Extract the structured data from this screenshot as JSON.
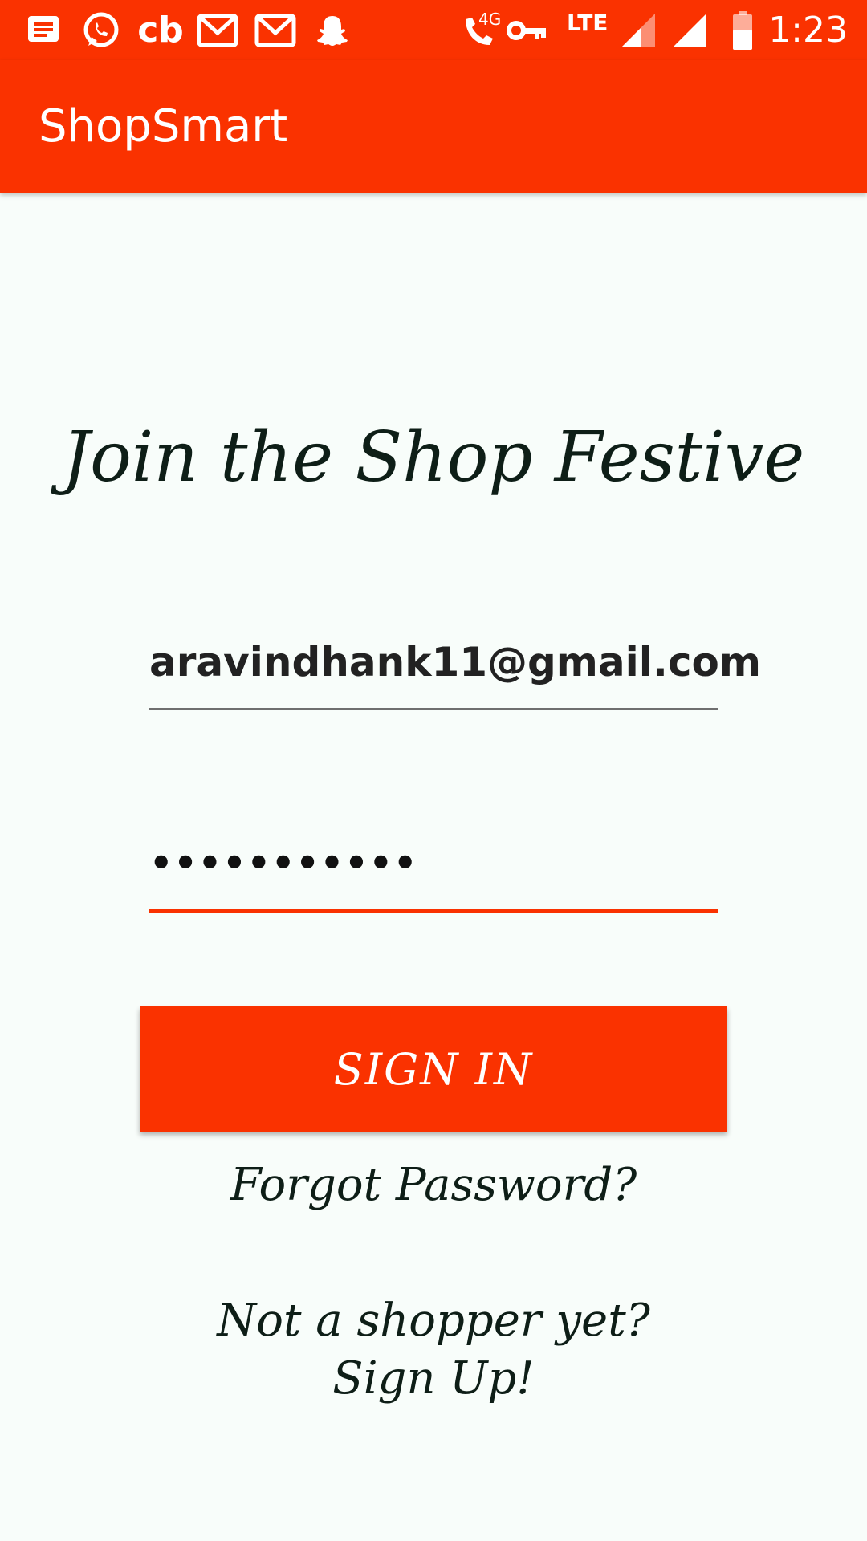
{
  "status_bar": {
    "time": "1:23",
    "network": "LTE",
    "call_network": "4G",
    "icons": [
      "message-icon",
      "whatsapp-icon",
      "cb-icon",
      "gmail-icon",
      "gmail-icon",
      "snapchat-icon",
      "call-4g-icon",
      "vpn-key-icon",
      "lte-icon",
      "signal-icon",
      "signal-icon",
      "battery-icon"
    ],
    "cb_label": "cb",
    "background": "#FA3200"
  },
  "app_bar": {
    "title": "ShopSmart",
    "background": "#FA3200"
  },
  "login": {
    "headline": "Join the Shop Festive",
    "email_value": "aravindhank11@gmail.com",
    "password_value": "•••••••••••",
    "sign_in_label": "SIGN IN",
    "forgot_label": "Forgot Password?",
    "signup_label": "Not a shopper yet? Sign Up!"
  },
  "colors": {
    "accent": "#FA3200",
    "background": "#F8FDFA",
    "text_dark": "#0E1E17"
  }
}
